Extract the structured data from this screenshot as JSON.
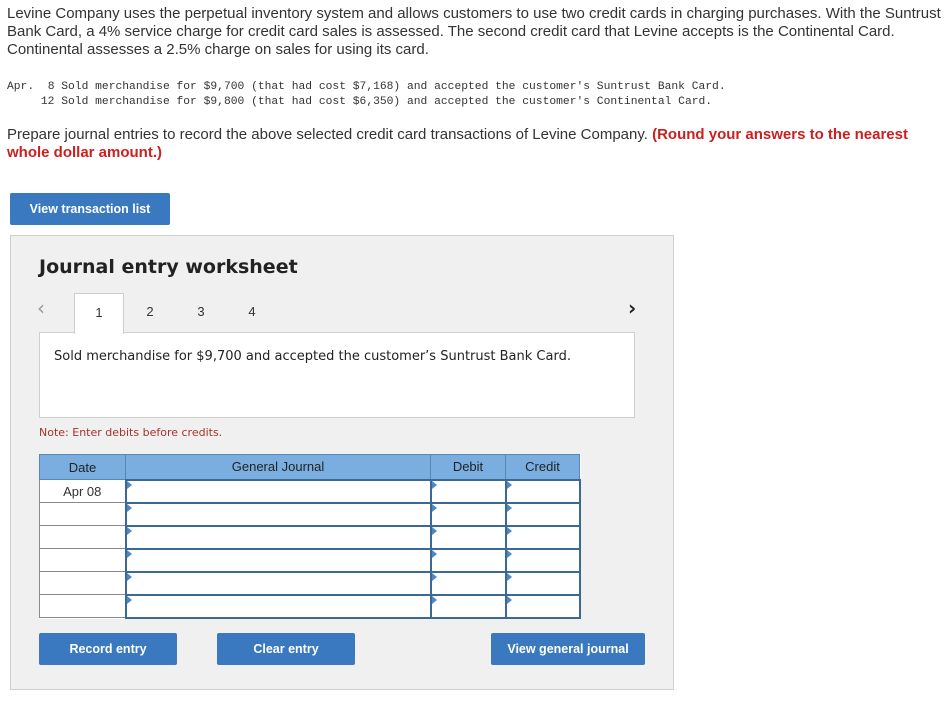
{
  "problem": {
    "intro": "Levine Company uses the perpetual inventory system and allows customers to use two credit cards in charging purchases. With the Suntrust Bank Card, a 4% service charge for credit card sales is assessed. The second credit card that Levine accepts is the Continental Card. Continental assesses a 2.5% charge on sales for using its card.",
    "transactions": [
      {
        "month": "Apr.",
        "day": "8",
        "text": "Sold merchandise for $9,700 (that had cost $7,168) and accepted the customer's Suntrust Bank Card."
      },
      {
        "month": "",
        "day": "12",
        "text": "Sold merchandise for $9,800 (that had cost $6,350) and accepted the customer's Continental Card."
      }
    ],
    "prompt": "Prepare journal entries to record the above selected credit card transactions of Levine Company.",
    "prompt_requirement": "(Round your answers to the nearest whole dollar amount.)"
  },
  "buttons": {
    "view_transaction_list": "View transaction list",
    "record_entry": "Record entry",
    "clear_entry": "Clear entry",
    "view_general_journal": "View general journal"
  },
  "worksheet": {
    "title": "Journal entry worksheet",
    "nav_prev_icon": "‹",
    "nav_next_icon": "›",
    "tabs": [
      {
        "label": "1",
        "active": true
      },
      {
        "label": "2",
        "active": false
      },
      {
        "label": "3",
        "active": false
      },
      {
        "label": "4",
        "active": false
      }
    ],
    "description": "Sold merchandise for $9,700 and accepted the customer’s Suntrust Bank Card.",
    "note": "Note: Enter debits before credits."
  },
  "journal": {
    "headers": {
      "date": "Date",
      "account": "General Journal",
      "debit": "Debit",
      "credit": "Credit"
    },
    "rows": [
      {
        "date": "Apr 08",
        "account": "",
        "debit": "",
        "credit": ""
      },
      {
        "date": "",
        "account": "",
        "debit": "",
        "credit": ""
      },
      {
        "date": "",
        "account": "",
        "debit": "",
        "credit": ""
      },
      {
        "date": "",
        "account": "",
        "debit": "",
        "credit": ""
      },
      {
        "date": "",
        "account": "",
        "debit": "",
        "credit": ""
      },
      {
        "date": "",
        "account": "",
        "debit": "",
        "credit": ""
      }
    ]
  },
  "colors": {
    "button_blue": "#3a79c0",
    "header_blue": "#7aaee0",
    "requirement_red": "#cc1f1f",
    "note_red": "#a8322c"
  }
}
